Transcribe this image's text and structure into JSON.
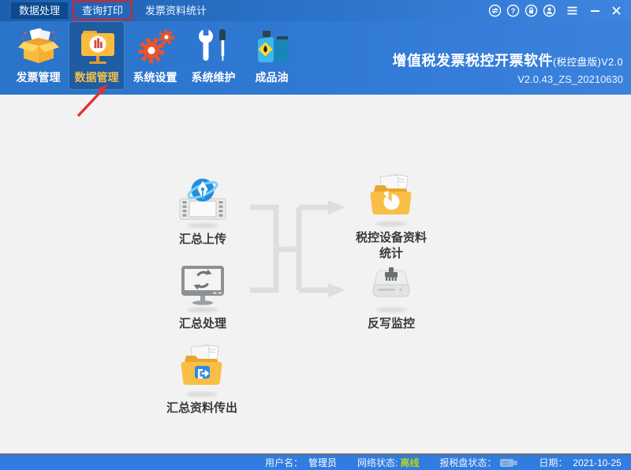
{
  "menubar": {
    "items": [
      {
        "label": "数据处理",
        "state": "active"
      },
      {
        "label": "查询打印",
        "state": "annotated"
      },
      {
        "label": "发票资料统计",
        "state": "normal"
      }
    ]
  },
  "window_controls": {
    "icons": [
      "sync-icon",
      "help-icon",
      "lock-icon",
      "user-icon",
      "menu-icon",
      "minimize-icon",
      "close-icon"
    ]
  },
  "toolbar": {
    "items": [
      {
        "label": "发票管理",
        "icon": "invoice-box-icon",
        "selected": false
      },
      {
        "label": "数据管理",
        "icon": "data-folder-icon",
        "selected": true
      },
      {
        "label": "系统设置",
        "icon": "gears-icon",
        "selected": false
      },
      {
        "label": "系统维护",
        "icon": "wrench-screwdriver-icon",
        "selected": false
      },
      {
        "label": "成品油",
        "icon": "oil-can-icon",
        "selected": false
      }
    ],
    "title_main": "增值税发票税控开票软件",
    "title_suffix": "(税控盘版)V2.0",
    "version": "V2.0.43_ZS_20210630"
  },
  "main": {
    "nodes": {
      "upload": {
        "label": "汇总上传",
        "icon": "globe-film-icon"
      },
      "stats": {
        "line1": "税控设备资料",
        "line2": "统计",
        "icon": "folder-piechart-icon"
      },
      "process": {
        "label": "汇总处理",
        "icon": "monitor-refresh-icon"
      },
      "writeback": {
        "label": "反写监控",
        "icon": "drive-brush-icon"
      },
      "export": {
        "label": "汇总资料传出",
        "icon": "folder-export-icon"
      }
    }
  },
  "statusbar": {
    "user_label": "用户名：",
    "user_value": "管理员",
    "network_label": "网络状态:",
    "network_value": "离线",
    "tax_disk_label": "报税盘状态：",
    "date_label": "日期：",
    "date_value": "2021-10-25"
  },
  "annotations": {
    "box_around": "查询打印",
    "arrow_points_to": "数据管理"
  },
  "colors": {
    "menubar_left": "#1c5fae",
    "toolbar_right": "#3b82dd",
    "menu_active_bg": "#0d4a8d",
    "statusbar_bg": "#317ce0",
    "offline_text": "#b8d417",
    "selected_tool_label": "#f2c14b",
    "annotation_red": "#e02020",
    "flow_arrow_gray": "#dedede",
    "main_bg": "#f2f2f3"
  }
}
